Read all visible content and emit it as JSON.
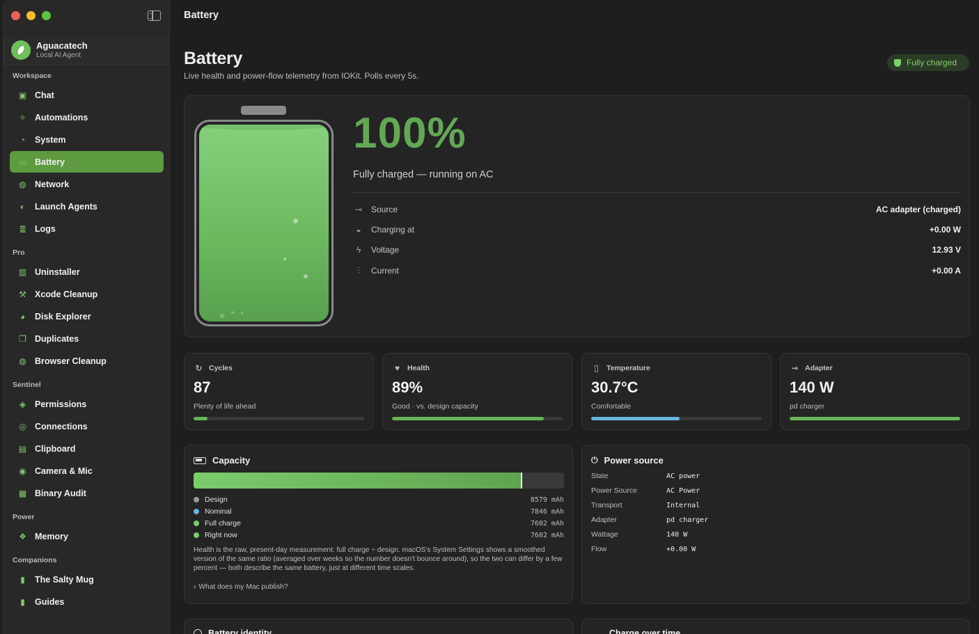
{
  "app": {
    "name": "Aguacatech",
    "subtitle": "Local AI Agent"
  },
  "sidebar": {
    "sections": [
      {
        "title": "Workspace",
        "items": [
          {
            "label": "Chat",
            "icon": "chat-icon"
          },
          {
            "label": "Automations",
            "icon": "wand-icon"
          },
          {
            "label": "System",
            "icon": "gauge-icon"
          },
          {
            "label": "Battery",
            "icon": "battery-icon",
            "active": true
          },
          {
            "label": "Network",
            "icon": "globe-icon"
          },
          {
            "label": "Launch Agents",
            "icon": "shield-icon"
          },
          {
            "label": "Logs",
            "icon": "list-icon"
          }
        ]
      },
      {
        "title": "Pro",
        "items": [
          {
            "label": "Uninstaller",
            "icon": "trash-icon"
          },
          {
            "label": "Xcode Cleanup",
            "icon": "hammer-icon"
          },
          {
            "label": "Disk Explorer",
            "icon": "pie-icon"
          },
          {
            "label": "Duplicates",
            "icon": "copy-icon"
          },
          {
            "label": "Browser Cleanup",
            "icon": "globe-icon"
          }
        ]
      },
      {
        "title": "Sentinel",
        "items": [
          {
            "label": "Permissions",
            "icon": "shield-check-icon"
          },
          {
            "label": "Connections",
            "icon": "network-icon"
          },
          {
            "label": "Clipboard",
            "icon": "clipboard-icon"
          },
          {
            "label": "Camera & Mic",
            "icon": "camera-icon"
          },
          {
            "label": "Binary Audit",
            "icon": "binary-icon"
          }
        ]
      },
      {
        "title": "Power",
        "items": [
          {
            "label": "Memory",
            "icon": "memory-icon"
          }
        ]
      },
      {
        "title": "Companions",
        "items": [
          {
            "label": "The Salty Mug",
            "icon": "mug-icon"
          },
          {
            "label": "Guides",
            "icon": "book-icon"
          }
        ]
      }
    ]
  },
  "header": {
    "toolbar_title": "Battery",
    "title": "Battery",
    "subtitle": "Live health and power-flow telemetry from IOKit. Polls every 5s.",
    "status_pill": "Fully charged"
  },
  "hero": {
    "percent_label": "100%",
    "charge_level": 1.0,
    "status": "Fully charged — running on AC",
    "rows": [
      {
        "label": "Source",
        "value": "AC adapter (charged)",
        "icon": "plug-icon"
      },
      {
        "label": "Charging at",
        "value": "+0.00 W",
        "icon": "speed-icon"
      },
      {
        "label": "Voltage",
        "value": "12.93 V",
        "icon": "bolt-icon"
      },
      {
        "label": "Current",
        "value": "+0.00 A",
        "icon": "waveform-icon"
      }
    ]
  },
  "stats": [
    {
      "label": "Cycles",
      "value": "87",
      "note": "Plenty of life ahead",
      "fill": 0.08,
      "color": "#66b556",
      "icon": "cycle-icon"
    },
    {
      "label": "Health",
      "value": "89%",
      "note": "Good · vs. design capacity",
      "fill": 0.89,
      "color": "#66b556",
      "icon": "heart-icon"
    },
    {
      "label": "Temperature",
      "value": "30.7°C",
      "note": "Comfortable",
      "fill": 0.52,
      "color": "#69b3e0",
      "icon": "thermometer-icon"
    },
    {
      "label": "Adapter",
      "value": "140 W",
      "note": "pd charger",
      "fill": 1.0,
      "color": "#66b556",
      "icon": "plug-icon"
    }
  ],
  "capacity": {
    "title": "Capacity",
    "bar_fill": 0.886,
    "legend": [
      {
        "label": "Design",
        "value": "8579 mAh",
        "color": "#9a9a9a"
      },
      {
        "label": "Nominal",
        "value": "7846 mAh",
        "color": "#69b3e0"
      },
      {
        "label": "Full charge",
        "value": "7602 mAh",
        "color": "#7ccc6c"
      },
      {
        "label": "Right now",
        "value": "7602 mAh",
        "color": "#7ccc6c"
      }
    ],
    "note": "Health is the raw, present-day measurement: full charge ÷ design. macOS's System Settings shows a smoothed version of the same ratio (averaged over weeks so the number doesn't bounce around), so the two can differ by a few percent — both describe the same battery, just at different time scales.",
    "link": "What does my Mac publish?"
  },
  "power_source": {
    "title": "Power source",
    "rows": [
      {
        "key": "State",
        "value": "AC power"
      },
      {
        "key": "Power Source",
        "value": "AC Power"
      },
      {
        "key": "Transport",
        "value": "Internal"
      },
      {
        "key": "Adapter",
        "value": "pd charger"
      },
      {
        "key": "Wattage",
        "value": "140 W"
      },
      {
        "key": "Flow",
        "value": "+0.00 W"
      }
    ]
  },
  "bottom_cards": [
    {
      "title": "Battery identity"
    },
    {
      "title": "Charge over time"
    }
  ],
  "colors": {
    "accent": "#5e9a40",
    "percent": "#62a854",
    "background": "#1e1e1e"
  }
}
